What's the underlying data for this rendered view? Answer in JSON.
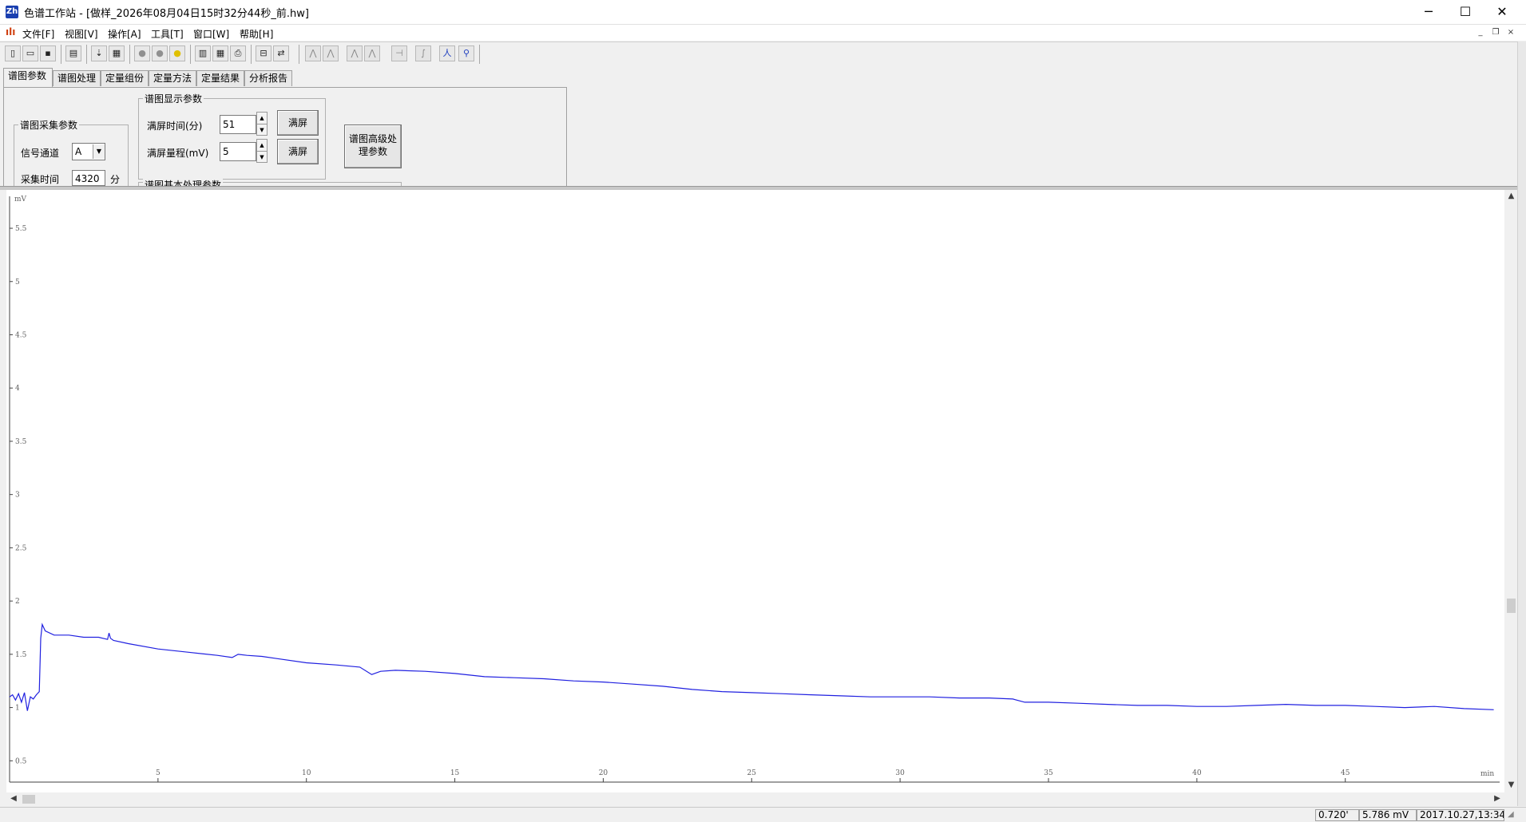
{
  "window": {
    "title": "色谱工作站 - [做样_2026年08月04日15时32分44秒_前.hw]",
    "app_icon_text": "Zh",
    "minimize": "─",
    "maximize": "☐",
    "close": "✕"
  },
  "menu": {
    "items": [
      "文件[F]",
      "视图[V]",
      "操作[A]",
      "工具[T]",
      "窗口[W]",
      "帮助[H]"
    ],
    "mdi_minimize": "_",
    "mdi_restore": "❐",
    "mdi_close": "×"
  },
  "toolbar": {
    "icons": [
      "new-icon",
      "open-icon",
      "save-icon",
      "calibrate-icon",
      "import-icon",
      "grid-icon",
      "gray-circle-icon",
      "gray-circle-icon-2",
      "yellow-circle-icon",
      "calculator-icon",
      "table-icon",
      "print-icon",
      "export-icon",
      "transfer-icon",
      "peak-icon-1",
      "peak-icon-2",
      "peak-icon-3",
      "peak-icon-4",
      "baseline-icon",
      "integrate-icon",
      "person-icon-1",
      "person-icon-2"
    ]
  },
  "tabs": [
    "谱图参数",
    "谱图处理",
    "定量组份",
    "定量方法",
    "定量结果",
    "分析报告"
  ],
  "acquisition": {
    "group_title": "谱图采集参数",
    "channel_label": "信号通道",
    "channel_value": "A",
    "time_label": "采集时间",
    "time_value": "4320",
    "time_unit": "分"
  },
  "display": {
    "group_title": "谱图显示参数",
    "fullscreen_time_label": "满屏时间(分)",
    "fullscreen_time_value": "51",
    "fullscreen_range_label": "满屏量程(mV)",
    "fullscreen_range_value": "5",
    "fullscreen_button_1": "满屏",
    "fullscreen_button_2": "满屏",
    "basic_group_title": "谱图基本处理参数"
  },
  "advanced_button": {
    "line1": "谱图高级处",
    "line2": "理参数"
  },
  "chart_data": {
    "type": "line",
    "title": "",
    "ylabel": "mV",
    "xlabel": "min",
    "xlim": [
      0,
      50.2
    ],
    "ylim": [
      0.3,
      5.8
    ],
    "x_ticks": [
      5,
      10,
      15,
      20,
      25,
      30,
      35,
      40,
      45
    ],
    "x_tick_labels": [
      "5",
      "10",
      "15",
      "20",
      "25",
      "30",
      "35",
      "40",
      "45"
    ],
    "y_ticks": [
      0.5,
      1,
      1.5,
      2,
      2.5,
      3,
      3.5,
      4,
      4.5,
      5,
      5.5
    ],
    "y_tick_labels": [
      "0.5",
      "1",
      "1.5",
      "2",
      "2.5",
      "3",
      "3.5",
      "4",
      "4.5",
      "5",
      "5.5"
    ],
    "color": "#2020e0",
    "series": [
      {
        "x": [
          0,
          0.1,
          0.2,
          0.3,
          0.4,
          0.5,
          0.6,
          0.7,
          0.8,
          0.9,
          1.0,
          1.05,
          1.1,
          1.2,
          1.5,
          2.0,
          2.5,
          3.0,
          3.3,
          3.35,
          3.4,
          3.5,
          4.0,
          5.0,
          6.0,
          7.0,
          7.5,
          7.7,
          8.0,
          8.5,
          9.0,
          10.0,
          11.0,
          11.8,
          12.2,
          12.5,
          13.0,
          14.0,
          15.0,
          16.0,
          17.0,
          18.0,
          19.0,
          20.0,
          21.0,
          22.0,
          23.0,
          24.0,
          25.0,
          26.0,
          27.0,
          28.0,
          29.0,
          30.0,
          31.0,
          32.0,
          33.0,
          33.8,
          34.2,
          35.0,
          36.0,
          37.0,
          38.0,
          39.0,
          40.0,
          41.0,
          42.0,
          43.0,
          44.0,
          45.0,
          46.0,
          47.0,
          48.0,
          49.0,
          50.0
        ],
        "y": [
          1.1,
          1.12,
          1.07,
          1.13,
          1.05,
          1.14,
          0.97,
          1.1,
          1.08,
          1.12,
          1.15,
          1.65,
          1.78,
          1.72,
          1.68,
          1.68,
          1.66,
          1.66,
          1.64,
          1.7,
          1.65,
          1.63,
          1.6,
          1.55,
          1.52,
          1.49,
          1.47,
          1.5,
          1.49,
          1.48,
          1.46,
          1.42,
          1.4,
          1.38,
          1.31,
          1.34,
          1.35,
          1.34,
          1.32,
          1.29,
          1.28,
          1.27,
          1.25,
          1.24,
          1.22,
          1.2,
          1.17,
          1.15,
          1.14,
          1.13,
          1.12,
          1.11,
          1.1,
          1.1,
          1.1,
          1.09,
          1.09,
          1.08,
          1.05,
          1.05,
          1.04,
          1.03,
          1.02,
          1.02,
          1.01,
          1.01,
          1.02,
          1.03,
          1.02,
          1.02,
          1.01,
          1.0,
          1.01,
          0.99,
          0.98
        ]
      }
    ]
  },
  "status": {
    "time": "0.720'",
    "value": "5.786 mV",
    "datetime": "2017.10.27,13:34:20"
  }
}
